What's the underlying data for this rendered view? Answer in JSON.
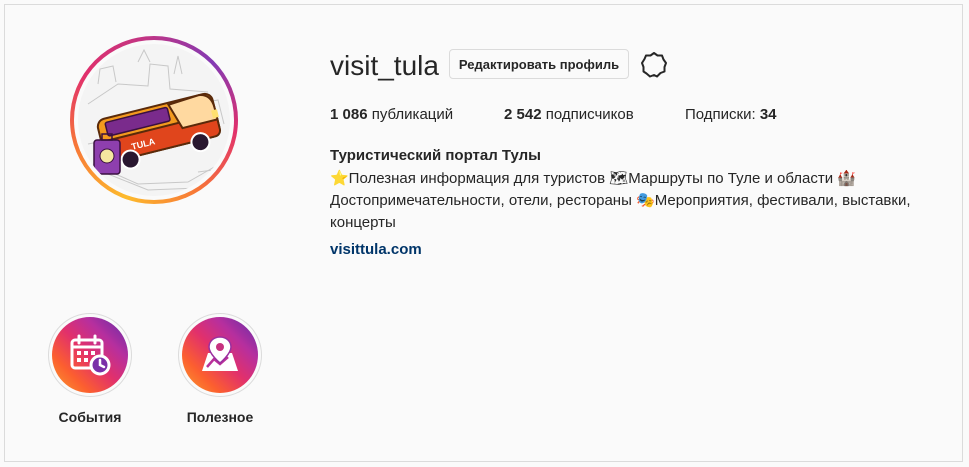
{
  "profile": {
    "username": "visit_tula",
    "edit_button": "Редактировать профиль",
    "settings_icon": "gear-icon"
  },
  "stats": {
    "posts_count": "1 086",
    "posts_label": "публикаций",
    "followers_count": "2 542",
    "followers_label": "подписчиков",
    "following_label": "Подписки:",
    "following_count": "34"
  },
  "bio": {
    "name": "Туристический портал Тулы",
    "line1": "⭐Полезная информация для туристов 🗺Маршруты по Туле и области 🏰",
    "line2": "Достопримечательности, отели, рестораны 🎭Мероприятия, фестивали, выставки,",
    "line3": "концерты",
    "link": "visittula.com"
  },
  "avatar": {
    "icon": "bus-avatar-icon",
    "bus_text": "TULA"
  },
  "highlights": [
    {
      "label": "События",
      "icon": "calendar-clock-icon"
    },
    {
      "label": "Полезное",
      "icon": "map-pin-icon"
    }
  ],
  "colors": {
    "text": "#262626",
    "link": "#003569",
    "border": "#dbdbdb",
    "background": "#fafafa",
    "gradient_start": "#f9a12e",
    "gradient_mid": "#e1306c",
    "gradient_end": "#5b2ca8"
  }
}
